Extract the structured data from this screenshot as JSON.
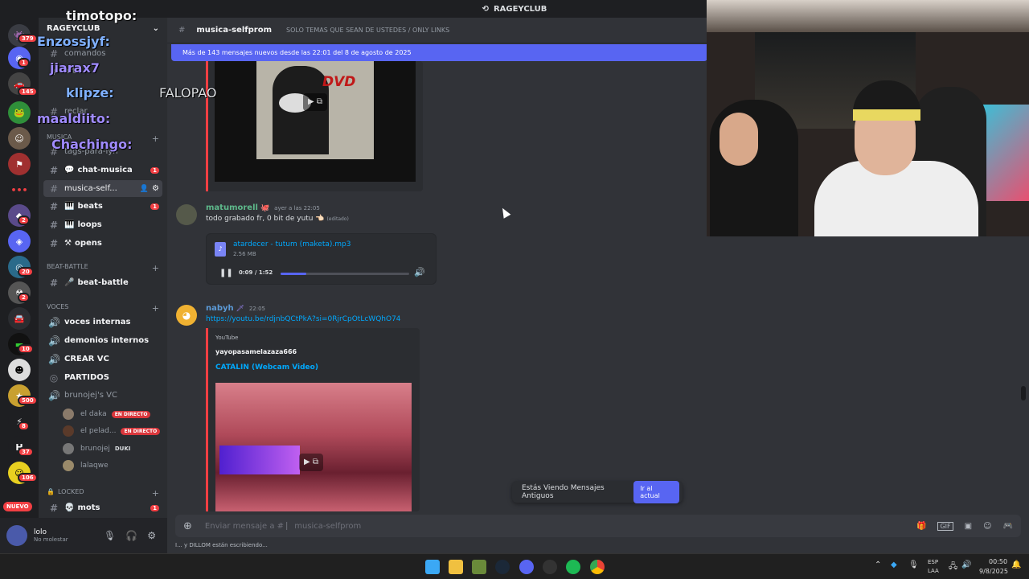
{
  "titlebar": {
    "server_name": "RAGEYCLUB"
  },
  "server_badges": [
    "379",
    "1",
    "145",
    "2",
    "2",
    "20",
    "2",
    "10",
    "500",
    "8",
    "37",
    "106"
  ],
  "server_new_label": "NUEVO",
  "sidebar": {
    "server_title": "RAGEYCLUB",
    "channels_top": [
      {
        "label": "comandos"
      },
      {
        "label": "arte"
      },
      {
        "label": "reclar"
      }
    ],
    "category_musica": "MUSICA",
    "musica_channels": [
      {
        "label": "tags-para-lyn",
        "badge": ""
      },
      {
        "label": "chat-musica",
        "badge": "1"
      },
      {
        "label": "musica-self...",
        "badge": ""
      },
      {
        "label": "beats",
        "badge": "1"
      },
      {
        "label": "loops",
        "badge": ""
      },
      {
        "label": "opens",
        "badge": ""
      }
    ],
    "category_beat": "BEAT-BATTLE",
    "beat_channel": "beat-battle",
    "category_voces": "VOCES",
    "voice_channels": [
      "voces internas",
      "demonios internos",
      "CREAR VC",
      "PARTIDOS"
    ],
    "brunojej_vc": "brunojej's VC",
    "voice_users": [
      {
        "name": "el daka",
        "tag": "EN DIRECTO"
      },
      {
        "name": "el pelad...",
        "tag": "EN DIRECTO"
      },
      {
        "name": "brunojej",
        "tag": "DUKI"
      },
      {
        "name": "lalaqwe",
        "tag": ""
      }
    ],
    "category_locked": "LOCKED",
    "locked_channel": "mots",
    "locked_badge": "1"
  },
  "user_panel": {
    "name": "lolo",
    "status": "No molestar"
  },
  "chat_header": {
    "channel": "musica-selfprom",
    "topic": "SOLO TEMAS QUE SEAN DE USTEDES / ONLY LINKS"
  },
  "new_messages_bar": "Más de 143 mensajes nuevos desde las 22:01 del 8 de agosto de 2025",
  "messages": {
    "m1": {
      "author": "matumorell",
      "time": "ayer a las 22:05",
      "text": "todo grabado fr, 0 bit de yutu 👈🏻",
      "edited": "(editado)",
      "attachment": {
        "filename": "atardecer - tutum (maketa).mp3",
        "size": "2.56 MB",
        "time": "0:09 / 1:52",
        "progress": 0.2
      }
    },
    "m2": {
      "author": "nabyh",
      "time": "22:05",
      "link": "https://youtu.be/rdjnbQCtPkA?si=0RjrCpOtLcWQhO74",
      "embed": {
        "provider": "YouTube",
        "author": "yayopasamelazaza666",
        "title": "CATALIN (Webcam Video)"
      }
    }
  },
  "input_placeholder": "Enviar mensaje a #  ⎸musica-selfprom",
  "typing": "I... y DILLOM están escribiendo...",
  "stale_banner": {
    "text": "Estás Viendo Mensajes Antiguos",
    "button": "Ir al actual"
  },
  "overlay_chat": [
    {
      "user": "timotopo:"
    },
    {
      "user": "Enzossjyf:"
    },
    {
      "user": "jiarax7"
    },
    {
      "user": "klipze:",
      "text": "FALOPAO"
    },
    {
      "user": "maaldiito:"
    },
    {
      "user": "Chachingo:"
    }
  ],
  "dvd_text": "DVD",
  "taskbar": {
    "lang1": "ESP",
    "lang2": "LAA",
    "time": "00:50",
    "date": "9/8/2025"
  }
}
